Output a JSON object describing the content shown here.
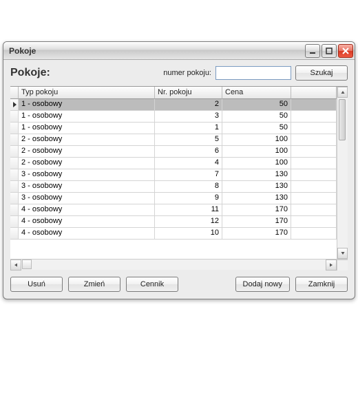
{
  "window": {
    "title": "Pokoje"
  },
  "header": {
    "heading": "Pokoje:",
    "search_label": "numer pokoju:",
    "search_value": "",
    "search_button": "Szukaj"
  },
  "grid": {
    "columns": {
      "c1": "Typ pokoju",
      "c2": "Nr. pokoju",
      "c3": "Cena"
    },
    "rows": [
      {
        "typ": "1 - osobowy",
        "nr": "2",
        "cena": "50",
        "selected": true
      },
      {
        "typ": "1 - osobowy",
        "nr": "3",
        "cena": "50",
        "selected": false
      },
      {
        "typ": "1 - osobowy",
        "nr": "1",
        "cena": "50",
        "selected": false
      },
      {
        "typ": "2 - osobowy",
        "nr": "5",
        "cena": "100",
        "selected": false
      },
      {
        "typ": "2 - osobowy",
        "nr": "6",
        "cena": "100",
        "selected": false
      },
      {
        "typ": "2 - osobowy",
        "nr": "4",
        "cena": "100",
        "selected": false
      },
      {
        "typ": "3 - osobowy",
        "nr": "7",
        "cena": "130",
        "selected": false
      },
      {
        "typ": "3 - osobowy",
        "nr": "8",
        "cena": "130",
        "selected": false
      },
      {
        "typ": "3 - osobowy",
        "nr": "9",
        "cena": "130",
        "selected": false
      },
      {
        "typ": "4 - osobowy",
        "nr": "11",
        "cena": "170",
        "selected": false
      },
      {
        "typ": "4 - osobowy",
        "nr": "12",
        "cena": "170",
        "selected": false
      },
      {
        "typ": "4 - osobowy",
        "nr": "10",
        "cena": "170",
        "selected": false
      }
    ]
  },
  "footer": {
    "delete": "Usuń",
    "change": "Zmień",
    "pricelist": "Cennik",
    "add_new": "Dodaj nowy",
    "close": "Zamknij"
  }
}
